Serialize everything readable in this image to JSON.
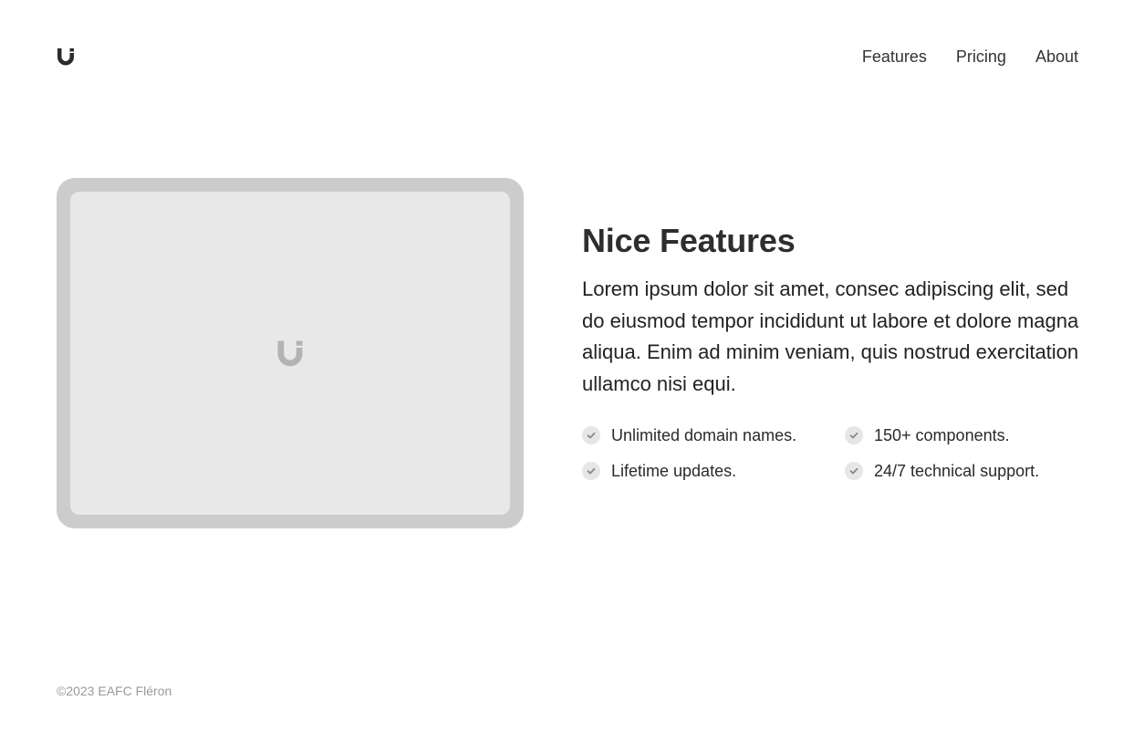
{
  "header": {
    "logo_icon": "brand-u-logo-icon",
    "nav": [
      {
        "label": "Features"
      },
      {
        "label": "Pricing"
      },
      {
        "label": "About"
      }
    ]
  },
  "hero": {
    "image_placeholder_icon": "brand-u-logo-icon",
    "title": "Nice Features",
    "description": "Lorem ipsum dolor sit amet, consec adipiscing elit, sed do eiusmod tempor incididunt ut labore et dolore magna aliqua. Enim ad minim veniam, quis nostrud exercitation ullamco nisi equi.",
    "features": [
      {
        "label": "Unlimited domain names.",
        "icon": "check-icon"
      },
      {
        "label": "150+ components.",
        "icon": "check-icon"
      },
      {
        "label": "Lifetime updates.",
        "icon": "check-icon"
      },
      {
        "label": "24/7 technical support.",
        "icon": "check-icon"
      }
    ]
  },
  "footer": {
    "copyright": "©2023 EAFC Fléron"
  },
  "colors": {
    "text": "#2e2e2e",
    "muted": "#9a9a9a",
    "device_frame": "#cccccc",
    "device_screen": "#e8e8e8",
    "check_bg": "#e6e6e6"
  }
}
